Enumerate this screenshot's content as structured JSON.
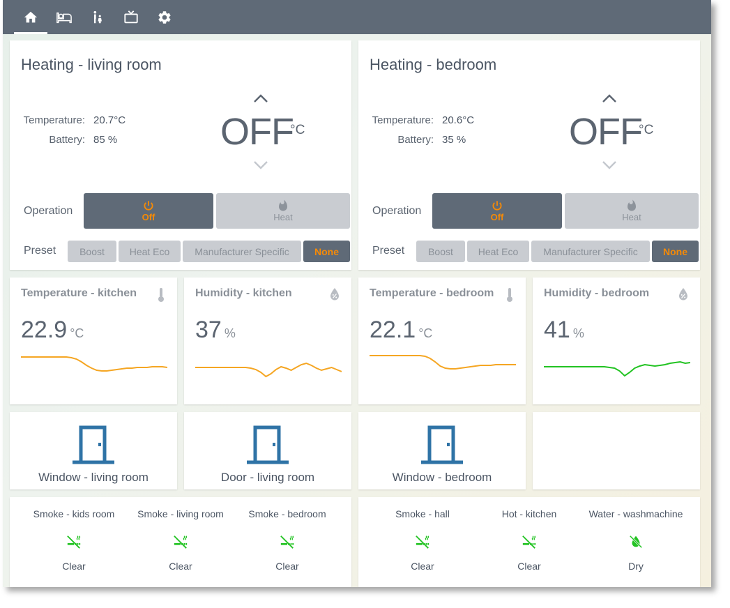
{
  "nav": {
    "tabs": [
      {
        "icon": "home-icon",
        "active": true
      },
      {
        "icon": "bed-icon",
        "active": false
      },
      {
        "icon": "family-icon",
        "active": false
      },
      {
        "icon": "tv-icon",
        "active": false
      },
      {
        "icon": "gear-icon",
        "active": false
      }
    ]
  },
  "colors": {
    "topbar": "#5f6a77",
    "accent": "#f58a07",
    "sparkline_orange": "#f5a623",
    "sparkline_green": "#22c322",
    "door_blue": "#2f73a6",
    "clear_green": "#22c322"
  },
  "heating": [
    {
      "title": "Heating - living room",
      "temperature_label": "Temperature:",
      "temperature_value": "20.7°C",
      "battery_label": "Battery:",
      "battery_value": "85 %",
      "setpoint": "OFF",
      "setpoint_unit": "°C",
      "operation_label": "Operation",
      "operation_options": [
        {
          "label": "Off",
          "icon": "power-icon",
          "selected": true
        },
        {
          "label": "Heat",
          "icon": "flame-icon",
          "selected": false
        }
      ],
      "preset_label": "Preset",
      "presets": [
        {
          "label": "Boost",
          "selected": false
        },
        {
          "label": "Heat Eco",
          "selected": false
        },
        {
          "label": "Manufacturer Specific",
          "selected": false
        },
        {
          "label": "None",
          "selected": true
        }
      ]
    },
    {
      "title": "Heating - bedroom",
      "temperature_label": "Temperature:",
      "temperature_value": "20.6°C",
      "battery_label": "Battery:",
      "battery_value": "35 %",
      "setpoint": "OFF",
      "setpoint_unit": "°C",
      "operation_label": "Operation",
      "operation_options": [
        {
          "label": "Off",
          "icon": "power-icon",
          "selected": true
        },
        {
          "label": "Heat",
          "icon": "flame-icon",
          "selected": false
        }
      ],
      "preset_label": "Preset",
      "presets": [
        {
          "label": "Boost",
          "selected": false
        },
        {
          "label": "Heat Eco",
          "selected": false
        },
        {
          "label": "Manufacturer Specific",
          "selected": false
        },
        {
          "label": "None",
          "selected": true
        }
      ]
    }
  ],
  "sensors": [
    {
      "title": "Temperature - kitchen",
      "value": "22.9",
      "unit": "°C",
      "icon": "thermometer-icon",
      "line_color": "#f5a623",
      "trend": [
        50,
        50,
        50,
        50,
        50,
        50,
        50,
        50,
        50,
        50,
        49,
        47,
        43,
        38,
        34,
        31,
        30,
        30,
        31,
        32,
        33,
        34,
        34,
        35,
        35,
        35,
        36,
        36,
        36,
        35
      ]
    },
    {
      "title": "Humidity - kitchen",
      "value": "37",
      "unit": "%",
      "icon": "water-percent-icon",
      "line_color": "#f5a623",
      "trend": [
        35,
        35,
        35,
        35,
        35,
        35,
        35,
        35,
        35,
        35,
        35,
        34,
        32,
        28,
        22,
        26,
        32,
        36,
        34,
        31,
        35,
        39,
        41,
        38,
        34,
        31,
        33,
        35,
        32,
        29
      ]
    },
    {
      "title": "Temperature - bedroom",
      "value": "22.1",
      "unit": "°C",
      "icon": "thermometer-icon",
      "line_color": "#f5a623",
      "trend": [
        52,
        52,
        52,
        52,
        52,
        52,
        52,
        52,
        52,
        52,
        52,
        51,
        48,
        43,
        37,
        34,
        33,
        33,
        34,
        35,
        36,
        37,
        38,
        38,
        38,
        39,
        39,
        39,
        39,
        39
      ]
    },
    {
      "title": "Humidity - bedroom",
      "value": "41",
      "unit": "%",
      "icon": "water-percent-icon",
      "line_color": "#22c322",
      "trend": [
        36,
        36,
        36,
        36,
        36,
        36,
        36,
        36,
        36,
        36,
        36,
        36,
        36,
        35,
        34,
        30,
        23,
        28,
        34,
        37,
        39,
        38,
        37,
        38,
        39,
        41,
        42,
        43,
        41,
        42
      ]
    }
  ],
  "doors": [
    {
      "label": "Window - living room",
      "icon": "door-closed-icon"
    },
    {
      "label": "Door - living room",
      "icon": "door-closed-icon"
    },
    {
      "label": "Window - bedroom",
      "icon": "door-closed-icon"
    }
  ],
  "alarms_left": [
    {
      "name": "Smoke - kids room",
      "state": "Clear",
      "icon": "smoke-off-icon"
    },
    {
      "name": "Smoke - living room",
      "state": "Clear",
      "icon": "smoke-off-icon"
    },
    {
      "name": "Smoke - bedroom",
      "state": "Clear",
      "icon": "smoke-off-icon"
    }
  ],
  "alarms_right": [
    {
      "name": "Smoke - hall",
      "state": "Clear",
      "icon": "smoke-off-icon"
    },
    {
      "name": "Hot - kitchen",
      "state": "Clear",
      "icon": "smoke-off-icon"
    },
    {
      "name": "Water - washmachine",
      "state": "Dry",
      "icon": "water-off-icon"
    }
  ]
}
